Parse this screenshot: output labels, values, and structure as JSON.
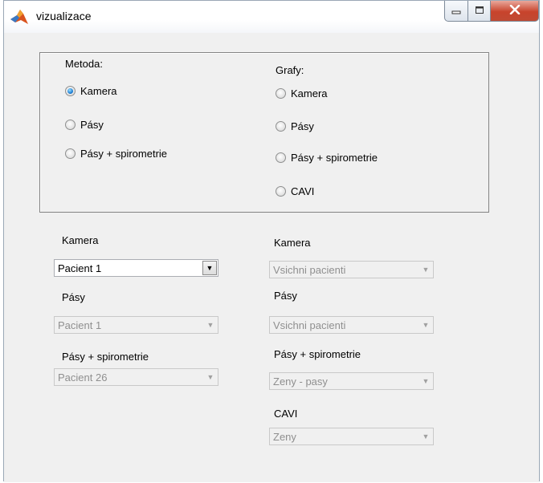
{
  "window": {
    "title": "vizualizace",
    "icon": "matlab-icon",
    "controls": [
      "minimize-icon",
      "maximize-icon",
      "close-icon"
    ]
  },
  "metoda": {
    "label": "Metoda:",
    "options": [
      {
        "label": "Kamera",
        "selected": true
      },
      {
        "label": "Pásy",
        "selected": false
      },
      {
        "label": "Pásy + spirometrie",
        "selected": false
      }
    ]
  },
  "grafy": {
    "label": "Grafy:",
    "options": [
      {
        "label": "Kamera",
        "selected": false
      },
      {
        "label": "Pásy",
        "selected": false
      },
      {
        "label": "Pásy + spirometrie",
        "selected": false
      },
      {
        "label": "CAVI",
        "selected": false
      }
    ]
  },
  "left": {
    "kamera": {
      "label": "Kamera",
      "value": "Pacient 1",
      "enabled": true
    },
    "pasy": {
      "label": "Pásy",
      "value": "Pacient 1",
      "enabled": false
    },
    "spiro": {
      "label": "Pásy + spirometrie",
      "value": "Pacient 26",
      "enabled": false
    }
  },
  "right": {
    "kamera": {
      "label": "Kamera",
      "value": "Vsichni pacienti",
      "enabled": false
    },
    "pasy": {
      "label": "Pásy",
      "value": "Vsichni pacienti",
      "enabled": false
    },
    "spiro": {
      "label": "Pásy + spirometrie",
      "value": "Zeny - pasy",
      "enabled": false
    },
    "cavi": {
      "label": "CAVI",
      "value": "Zeny",
      "enabled": false
    }
  },
  "colors": {
    "radio_selected": "#1f7fd4",
    "close_button": "#c8432c",
    "disabled_text": "#8f8f8f"
  }
}
